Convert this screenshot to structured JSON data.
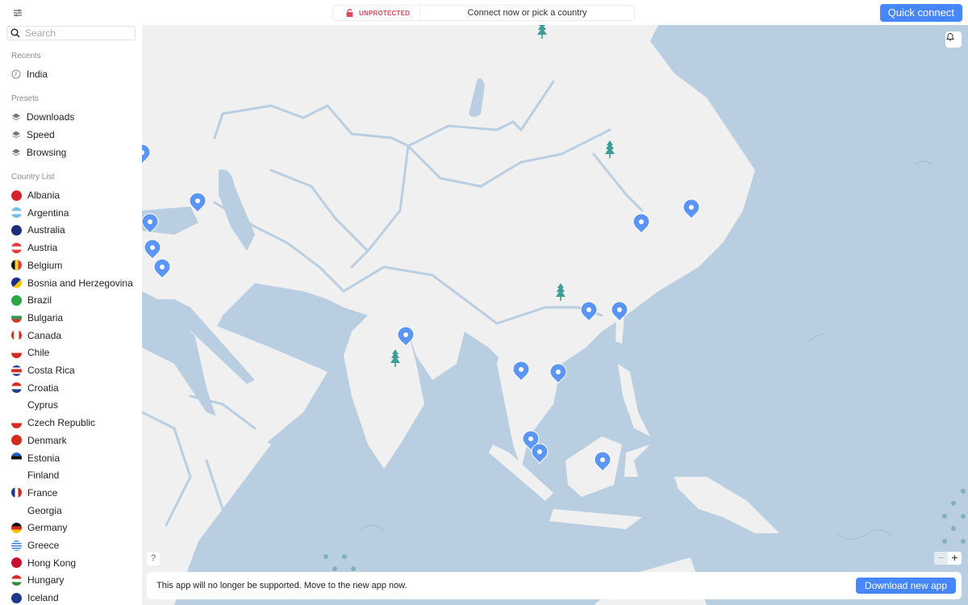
{
  "topbar": {
    "settings_icon": "sliders-icon",
    "status_label": "UNPROTECTED",
    "status_message": "Connect now or pick a country",
    "quick_connect_label": "Quick connect"
  },
  "sidebar": {
    "search": {
      "placeholder": "Search",
      "value": ""
    },
    "recents_label": "Recents",
    "recents": [
      {
        "label": "India",
        "icon": "clock-icon"
      }
    ],
    "presets_label": "Presets",
    "presets": [
      {
        "label": "Downloads",
        "icon": "layers-icon"
      },
      {
        "label": "Speed",
        "icon": "layers-icon"
      },
      {
        "label": "Browsing",
        "icon": "layers-icon"
      }
    ],
    "country_list_label": "Country List",
    "countries": [
      {
        "label": "Albania",
        "flag": "albania"
      },
      {
        "label": "Argentina",
        "flag": "argentina"
      },
      {
        "label": "Australia",
        "flag": "australia"
      },
      {
        "label": "Austria",
        "flag": "austria"
      },
      {
        "label": "Belgium",
        "flag": "belgium"
      },
      {
        "label": "Bosnia and Herzegovina",
        "flag": "bosnia"
      },
      {
        "label": "Brazil",
        "flag": "brazil"
      },
      {
        "label": "Bulgaria",
        "flag": "bulgaria"
      },
      {
        "label": "Canada",
        "flag": "canada"
      },
      {
        "label": "Chile",
        "flag": "chile"
      },
      {
        "label": "Costa Rica",
        "flag": "costa-rica"
      },
      {
        "label": "Croatia",
        "flag": "croatia"
      },
      {
        "label": "Cyprus",
        "flag": "cyprus"
      },
      {
        "label": "Czech Republic",
        "flag": "czech"
      },
      {
        "label": "Denmark",
        "flag": "denmark"
      },
      {
        "label": "Estonia",
        "flag": "estonia"
      },
      {
        "label": "Finland",
        "flag": "finland"
      },
      {
        "label": "France",
        "flag": "france"
      },
      {
        "label": "Georgia",
        "flag": "georgia"
      },
      {
        "label": "Germany",
        "flag": "germany"
      },
      {
        "label": "Greece",
        "flag": "greece"
      },
      {
        "label": "Hong Kong",
        "flag": "hong-kong"
      },
      {
        "label": "Hungary",
        "flag": "hungary"
      },
      {
        "label": "Iceland",
        "flag": "iceland"
      }
    ]
  },
  "map": {
    "help_label": "?",
    "zoom_out_label": "−",
    "zoom_in_label": "+",
    "bell_icon": "bell-icon",
    "pin_icon": "location-pin-icon",
    "tree_icon": "tree-icon",
    "colors": {
      "sea": "#b9cfe1",
      "land": "#f0f0f0",
      "pin": "#5b95f7",
      "tree": "#3e9e96"
    }
  },
  "banner": {
    "message": "This app will no longer be supported. Move to the new app now.",
    "button_label": "Download new app"
  },
  "colors": {
    "accent": "#4687ff",
    "unprotected": "#e0465d"
  }
}
